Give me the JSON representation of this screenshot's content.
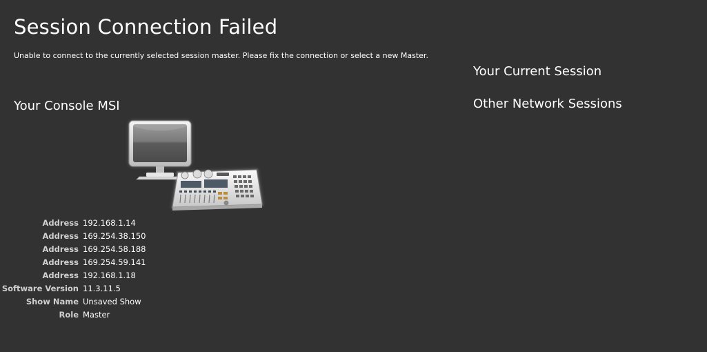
{
  "header": {
    "title": "Session Connection Failed",
    "message": "Unable to connect to the currently selected session master. Please fix the connection or select a new Master."
  },
  "console": {
    "heading": "Your Console MSI",
    "icon": "lighting-console-icon",
    "details": [
      {
        "label": "Address",
        "value": "192.168.1.14"
      },
      {
        "label": "Address",
        "value": "169.254.38.150"
      },
      {
        "label": "Address",
        "value": "169.254.58.188"
      },
      {
        "label": "Address",
        "value": "169.254.59.141"
      },
      {
        "label": "Address",
        "value": "192.168.1.18"
      },
      {
        "label": "Software Version",
        "value": "11.3.11.5"
      },
      {
        "label": "Show Name",
        "value": "Unsaved Show"
      },
      {
        "label": "Role",
        "value": "Master"
      }
    ]
  },
  "sessions": {
    "current_heading": "Your Current Session",
    "other_heading": "Other Network Sessions"
  },
  "colors": {
    "background": "#323232",
    "text": "#ffffff",
    "label": "#cfcfcf"
  }
}
